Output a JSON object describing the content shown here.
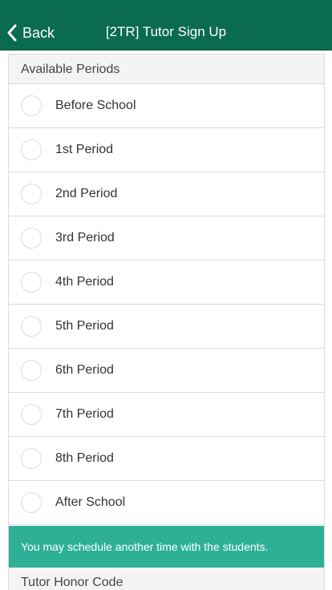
{
  "header": {
    "back_label": "Back",
    "title": "[2TR] Tutor Sign Up",
    "background_color": "#0b6b4f"
  },
  "periods_section": {
    "heading": "Available Periods",
    "items": [
      {
        "label": "Before School",
        "selected": false
      },
      {
        "label": "1st Period",
        "selected": false
      },
      {
        "label": "2nd Period",
        "selected": false
      },
      {
        "label": "3rd Period",
        "selected": false
      },
      {
        "label": "4th Period",
        "selected": false
      },
      {
        "label": "5th Period",
        "selected": false
      },
      {
        "label": "6th Period",
        "selected": false
      },
      {
        "label": "7th Period",
        "selected": false
      },
      {
        "label": "8th Period",
        "selected": false
      },
      {
        "label": "After School",
        "selected": false
      }
    ]
  },
  "notice": {
    "text": "You may schedule another time with the students.",
    "color": "#2eb097"
  },
  "honor_code_section": {
    "heading": "Tutor Honor Code"
  }
}
